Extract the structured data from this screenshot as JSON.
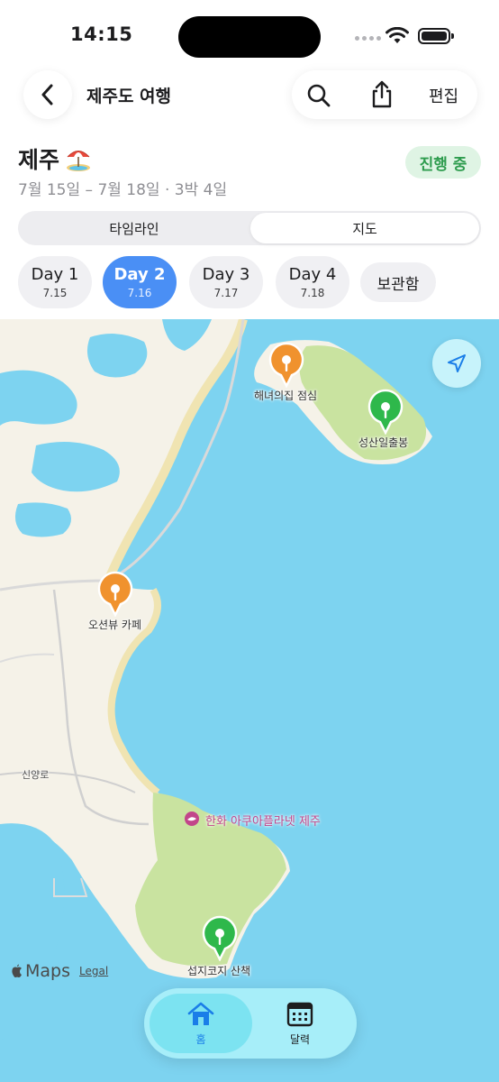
{
  "status": {
    "time": "14:15"
  },
  "nav": {
    "title": "제주도 여행",
    "edit_label": "편집"
  },
  "trip": {
    "title": "제주",
    "emoji": "beach-umbrella-icon",
    "dates": "7월 15일 – 7월 18일 · 3박 4일",
    "status_badge": "진행 중"
  },
  "segment": {
    "timeline": "타임라인",
    "map": "지도",
    "selected": "지도"
  },
  "days": [
    {
      "label": "Day 1",
      "date": "7.15",
      "active": false
    },
    {
      "label": "Day 2",
      "date": "7.16",
      "active": true
    },
    {
      "label": "Day 3",
      "date": "7.17",
      "active": false
    },
    {
      "label": "Day 4",
      "date": "7.18",
      "active": false
    }
  ],
  "archive_label": "보관함",
  "map": {
    "pins": [
      {
        "label": "해녀의집 점심",
        "color": "#f0922e"
      },
      {
        "label": "성산일출봉",
        "color": "#2eb84b"
      },
      {
        "label": "오션뷰 카페",
        "color": "#f0922e"
      },
      {
        "label": "섭지코지 산책",
        "color": "#2eb84b"
      }
    ],
    "poi": "한화 아쿠아플라넷 제주",
    "road_label": "신양로",
    "attribution": "Maps",
    "legal": "Legal",
    "colors": {
      "sea": "#7dd3f0",
      "land": "#f5f2e8",
      "park": "#c9e3a0",
      "sand": "#f2e6b8"
    }
  },
  "tabbar": {
    "home": {
      "label": "홈",
      "icon": "house-icon",
      "active": true
    },
    "calendar": {
      "label": "달력",
      "icon": "calendar-icon",
      "active": false
    }
  },
  "colors": {
    "accent": "#4a8ff5",
    "status_green": "#2e9c4e"
  }
}
